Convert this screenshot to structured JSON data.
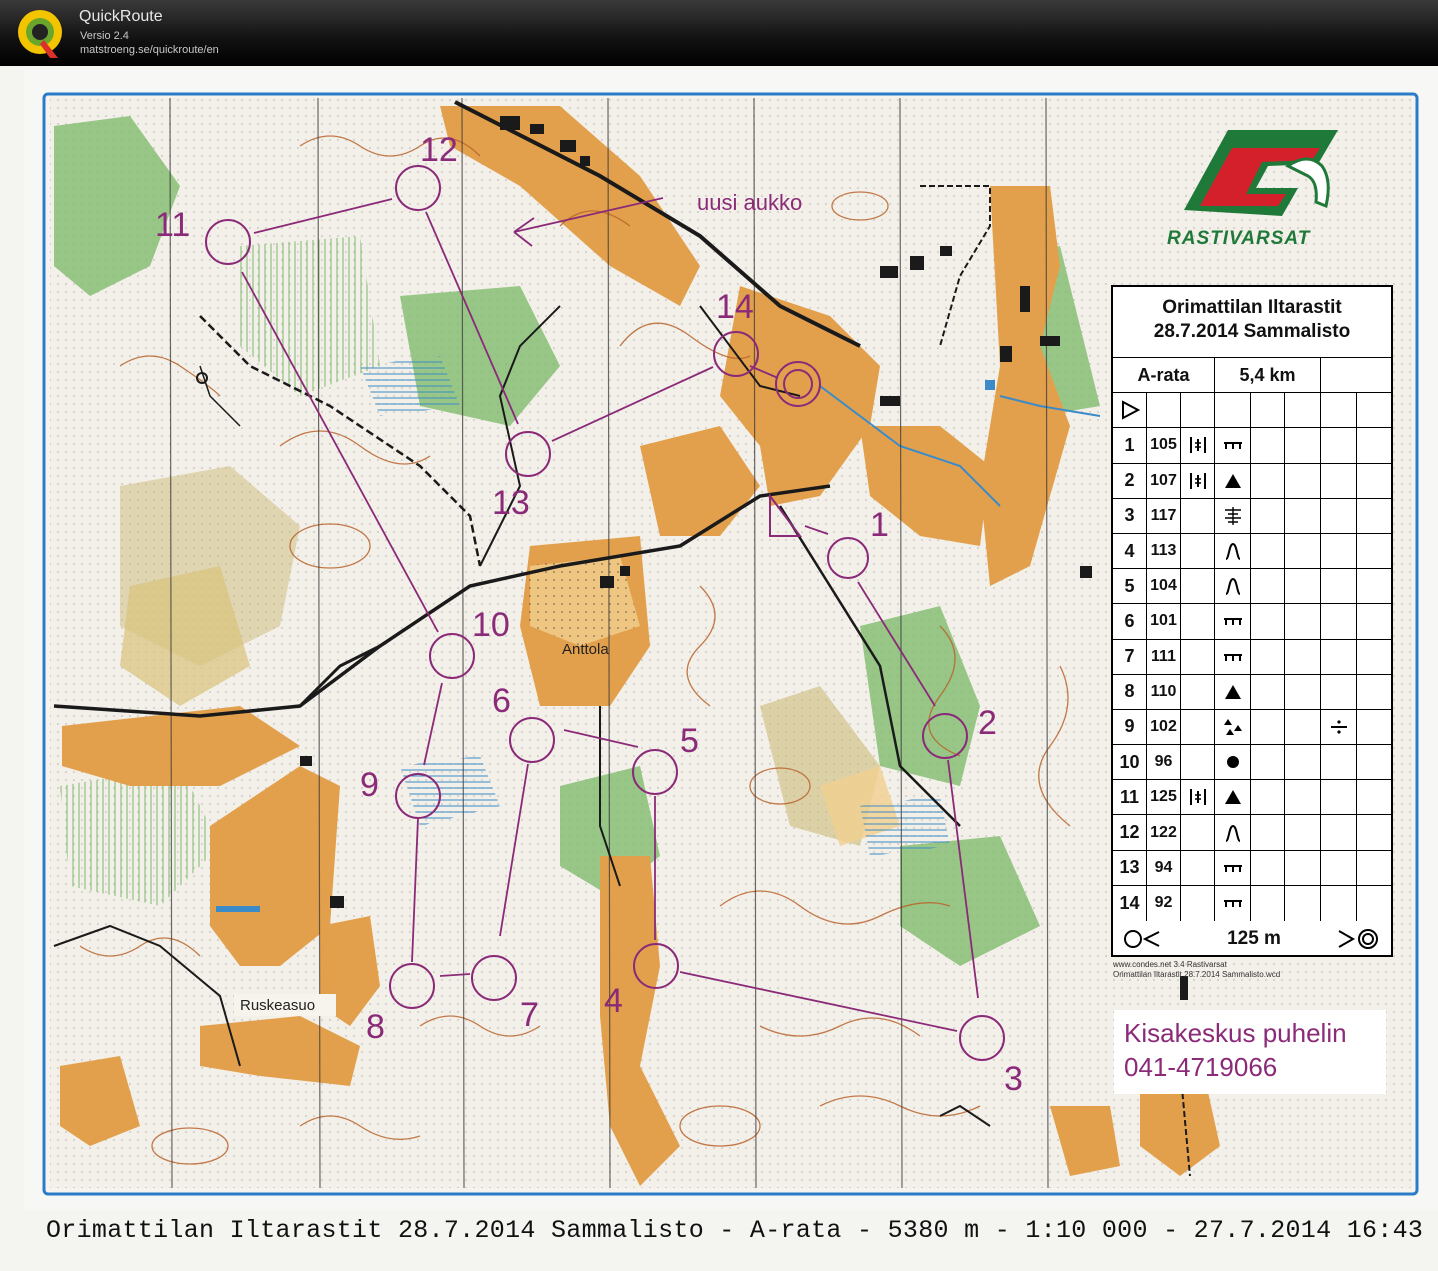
{
  "app": {
    "title": "QuickRoute",
    "version": "Versio 2.4",
    "url": "matstroeng.se/quickroute/en"
  },
  "map": {
    "annotation": "uusi aukko",
    "places": [
      "Anttola",
      "Ruskeasuo"
    ],
    "control_labels": [
      "1",
      "2",
      "3",
      "4",
      "5",
      "6",
      "7",
      "8",
      "9",
      "10",
      "11",
      "12",
      "13",
      "14"
    ],
    "brand_name": "RASTIVARSAT",
    "credit_line1": "www.condes.net 3.4 Rastivarsat",
    "credit_line2": "Orimattilan Iltarastit 28.7.2014 Sammalisto.wcd",
    "phone_label": "Kisakeskus puhelin",
    "phone_number": "041-4719066",
    "footer": "Orimattilan Iltarastit 28.7.2014 Sammalisto - A-rata - 5380 m - 1:10 000 - 27.7.2014 16:43",
    "colors": {
      "course": "#8a2a78",
      "open_land": "#e3a04c",
      "green": "#6fb25c",
      "contour": "#b8642c",
      "water": "#3a8bc7",
      "brand_red": "#d4202a",
      "brand_green": "#1f7a3a"
    }
  },
  "description_sheet": {
    "event": "Orimattilan Iltarastit",
    "date_place": "28.7.2014 Sammalisto",
    "course": "A-rata",
    "length": "5,4 km",
    "finish_distance": "125 m",
    "controls": [
      {
        "n": "1",
        "code": "105",
        "sym": "thicket",
        "feat": "fence"
      },
      {
        "n": "2",
        "code": "107",
        "sym": "thicket",
        "feat": "boulder"
      },
      {
        "n": "3",
        "code": "117",
        "sym": "",
        "feat": "marsh"
      },
      {
        "n": "4",
        "code": "113",
        "sym": "",
        "feat": "knoll"
      },
      {
        "n": "5",
        "code": "104",
        "sym": "",
        "feat": "knoll"
      },
      {
        "n": "6",
        "code": "101",
        "sym": "",
        "feat": "fence"
      },
      {
        "n": "7",
        "code": "111",
        "sym": "",
        "feat": "fence"
      },
      {
        "n": "8",
        "code": "110",
        "sym": "",
        "feat": "boulder"
      },
      {
        "n": "9",
        "code": "102",
        "sym": "",
        "feat": "boulders",
        "extra": "between"
      },
      {
        "n": "10",
        "code": "96",
        "sym": "",
        "feat": "dot"
      },
      {
        "n": "11",
        "code": "125",
        "sym": "thicket",
        "feat": "boulder"
      },
      {
        "n": "12",
        "code": "122",
        "sym": "",
        "feat": "knoll"
      },
      {
        "n": "13",
        "code": "94",
        "sym": "",
        "feat": "fence"
      },
      {
        "n": "14",
        "code": "92",
        "sym": "",
        "feat": "fence"
      }
    ]
  }
}
